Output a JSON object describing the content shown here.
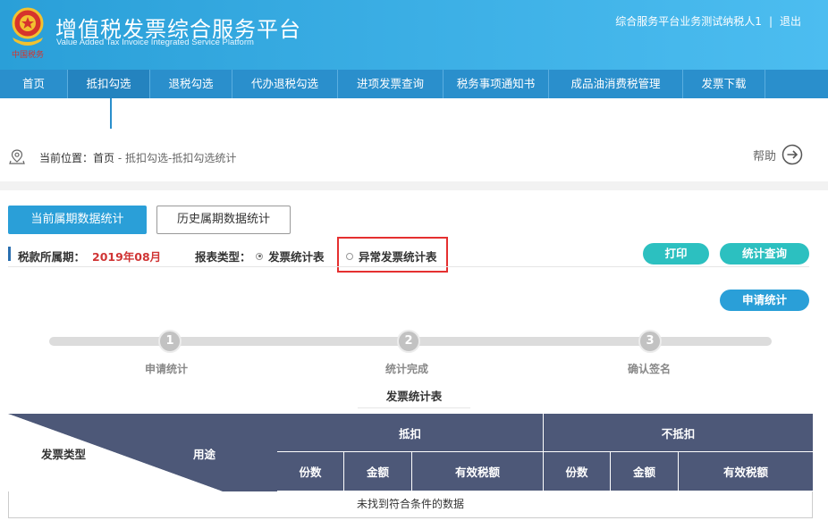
{
  "header": {
    "title_cn": "增值税发票综合服务平台",
    "title_en": "Value Added Tax Invoice Integrated Service Platform",
    "user": "综合服务平台业务测试纳税人1",
    "logout": "退出",
    "logo_icon": "tax-emblem-icon"
  },
  "nav": {
    "items": [
      "首页",
      "抵扣勾选",
      "退税勾选",
      "代办退税勾选",
      "进项发票查询",
      "税务事项通知书",
      "成品油消费税管理",
      "发票下载"
    ],
    "active_index": 1
  },
  "breadcrumb": {
    "prefix": "当前位置：",
    "home": "首页",
    "path": " - 抵扣勾选-抵扣勾选统计"
  },
  "help": {
    "label": "帮助"
  },
  "tabs": {
    "current": "当前属期数据统计",
    "history": "历史属期数据统计"
  },
  "filter": {
    "period_label": "税款所属期：",
    "period_value": "2019年08月",
    "report_type_label": "报表类型：",
    "options": [
      "发票统计表",
      "异常发票统计表"
    ],
    "selected": "发票统计表"
  },
  "actions": {
    "print": "打印",
    "query": "统计查询",
    "apply": "申请统计"
  },
  "steps": [
    {
      "num": "1",
      "label": "申请统计"
    },
    {
      "num": "2",
      "label": "统计完成"
    },
    {
      "num": "3",
      "label": "确认签名"
    }
  ],
  "table": {
    "title": "发票统计表",
    "corner_left": "发票类型",
    "corner_right": "用途",
    "groups": [
      "抵扣",
      "不抵扣"
    ],
    "columns": [
      "份数",
      "金额",
      "有效税额",
      "份数",
      "金额",
      "有效税额"
    ],
    "empty_text": "未找到符合条件的数据"
  },
  "colors": {
    "header": "#3db0e6",
    "nav": "#2a8fcc",
    "table_header": "#4d5878",
    "accent_teal": "#2cc0c0",
    "period_red": "#d03535",
    "highlight": "#e53030"
  }
}
